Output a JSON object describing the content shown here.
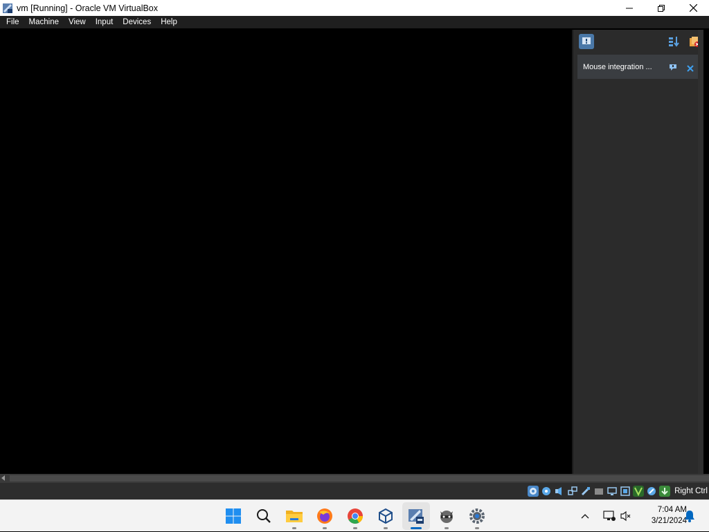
{
  "window": {
    "title": "vm [Running] - Oracle VM VirtualBox",
    "controls": {
      "minimize": "minimize-icon",
      "maximize": "maximize-icon",
      "close": "close-icon"
    }
  },
  "menubar": {
    "items": [
      "File",
      "Machine",
      "View",
      "Input",
      "Devices",
      "Help"
    ]
  },
  "notification_center": {
    "toolbar": {
      "left": "notification-center-icon",
      "sort": "sort-icon",
      "dismiss_all": "dismiss-all-icon"
    },
    "items": [
      {
        "text": "Mouse integration ...",
        "actions": [
          "help-icon",
          "close-icon"
        ]
      }
    ]
  },
  "statusbar": {
    "icons": [
      "hard-disk-icon",
      "optical-drive-icon",
      "audio-icon",
      "network-icon",
      "usb-icon",
      "shared-folders-icon",
      "display-icon",
      "recording-icon",
      "acceleration-icon",
      "mouse-integration-icon",
      "keyboard-capture-icon"
    ],
    "host_key": "Right Ctrl"
  },
  "taskbar": {
    "apps": [
      "start-icon",
      "search-icon",
      "file-explorer-icon",
      "firefox-icon",
      "chrome-icon",
      "virtualbox-icon",
      "virtualbox-vm-icon",
      "raccoon-app-icon",
      "settings-icon"
    ],
    "tray": {
      "chevron": "chevron-up-icon",
      "network": "network-icon",
      "volume": "volume-muted-icon",
      "notifications": "bell-icon"
    },
    "time": "7:04 AM",
    "date": "3/21/2024"
  },
  "colors": {
    "accent": "#0067c0",
    "menubar_bg": "#1f1f1f",
    "panel_bg": "#2b2b2b",
    "taskbar_bg": "#f3f3f3"
  }
}
